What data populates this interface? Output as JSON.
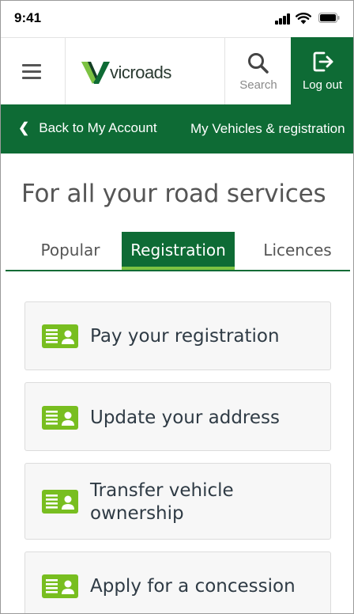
{
  "status_bar": {
    "time": "9:41"
  },
  "header": {
    "menu_icon": "hamburger-menu-icon",
    "logo_text": "vicroads",
    "search_label": "Search",
    "logout_label": "Log out"
  },
  "subnav": {
    "back_label": "Back to My Account",
    "vehicles_label": "My Vehicles & registration"
  },
  "page": {
    "title": "For all your road services"
  },
  "tabs": [
    {
      "label": "Popular",
      "active": false
    },
    {
      "label": "Registration",
      "active": true
    },
    {
      "label": "Licences",
      "active": false
    }
  ],
  "cards": [
    {
      "label": "Pay your registration",
      "icon": "id-card-icon"
    },
    {
      "label": "Update your address",
      "icon": "id-card-icon"
    },
    {
      "label_line1": "Transfer vehicle",
      "label_line2": "ownership",
      "icon": "id-card-icon"
    },
    {
      "label": "Apply for a concession",
      "icon": "id-card-icon"
    }
  ],
  "colors": {
    "brand_green": "#0e6b35",
    "accent_lime": "#7cc242",
    "icon_green": "#78be20"
  }
}
